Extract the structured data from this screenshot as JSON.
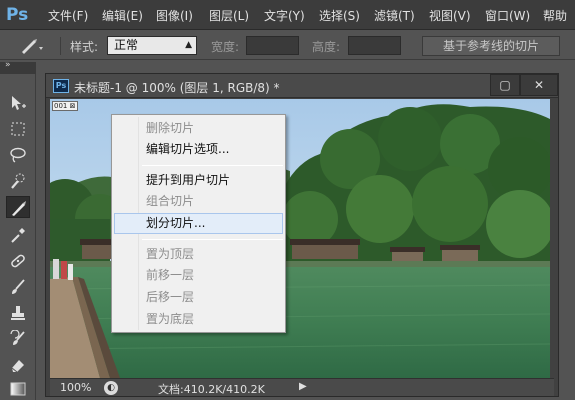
{
  "app": {
    "logo": "Ps"
  },
  "menubar": {
    "items": [
      "文件(F)",
      "编辑(E)",
      "图像(I)",
      "图层(L)",
      "文字(Y)",
      "选择(S)",
      "滤镜(T)",
      "视图(V)",
      "窗口(W)",
      "帮助"
    ]
  },
  "options": {
    "style_label": "样式:",
    "style_value": "正常",
    "width_label": "宽度:",
    "height_label": "高度:",
    "slice_guides_button": "基于参考线的切片"
  },
  "document": {
    "ps_badge": "Ps",
    "title": "未标题-1 @ 100% (图层 1, RGB/8) *",
    "slice_tag": "001 ⊠",
    "window_buttons": {
      "minimize": "▬",
      "maximize": "▢",
      "close": "✕"
    }
  },
  "statusbar": {
    "zoom": "100%",
    "doc_size": "文档:410.2K/410.2K",
    "menu_arrow": "▶"
  },
  "context_menu": {
    "items": [
      {
        "label": "删除切片",
        "enabled": false
      },
      {
        "label": "编辑切片选项...",
        "enabled": true
      },
      {
        "label": "提升到用户切片",
        "enabled": true
      },
      {
        "label": "组合切片",
        "enabled": false
      },
      {
        "label": "划分切片...",
        "enabled": true,
        "highlighted": true
      },
      {
        "label": "置为顶层",
        "enabled": false
      },
      {
        "label": "前移一层",
        "enabled": false
      },
      {
        "label": "后移一层",
        "enabled": false
      },
      {
        "label": "置为底层",
        "enabled": false
      }
    ]
  },
  "icons": {
    "slice_tool": "slice-tool-icon",
    "toolbox": [
      "move-tool-icon",
      "marquee-tool-icon",
      "lasso-tool-icon",
      "quick-selection-icon",
      "slice-tool-icon",
      "eyedropper-icon",
      "healing-brush-icon",
      "brush-tool-icon",
      "clone-stamp-icon",
      "history-brush-icon",
      "eraser-icon",
      "gradient-icon"
    ]
  },
  "colors": {
    "menu_bg": "#3c3c3c",
    "panel_bg": "#535353",
    "context_menu_bg": "#f0f0f0",
    "highlight": "#e3edf9"
  }
}
